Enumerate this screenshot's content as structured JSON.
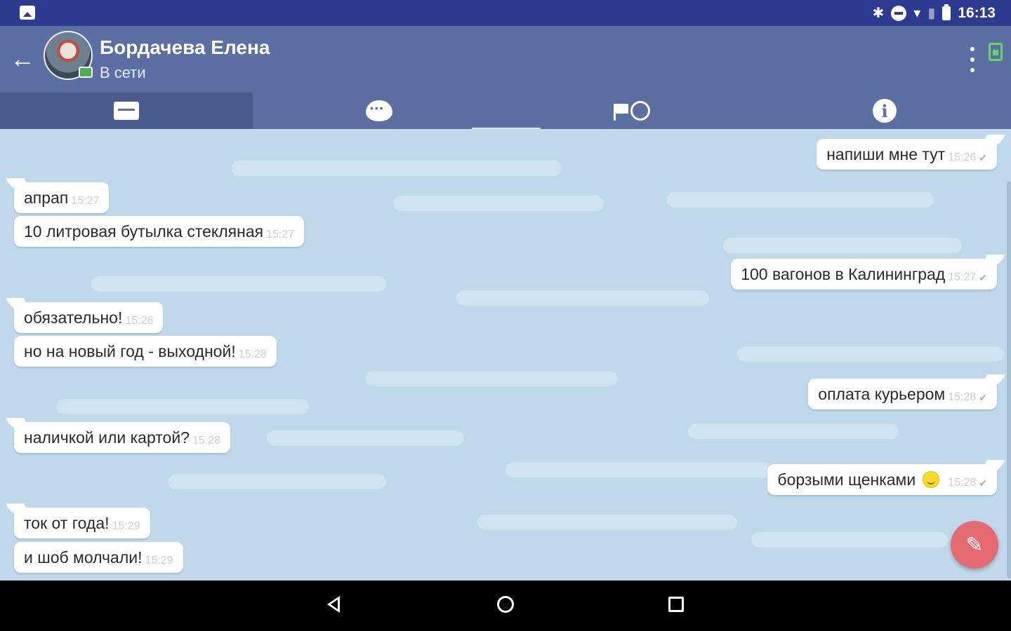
{
  "status_bar": {
    "time": "16:13",
    "icons": [
      "gallery-icon",
      "bluetooth-icon",
      "dnd-icon",
      "wifi-icon",
      "no-sim-icon",
      "battery-icon"
    ],
    "bg_color": "#2c3a8f"
  },
  "header": {
    "contact_name": "Бордачева Елена",
    "contact_status": "В сети",
    "bg_color": "#5c6fa3"
  },
  "tabs": [
    {
      "icon": "folder-icon",
      "active": true
    },
    {
      "icon": "chat-bubble-icon",
      "active": false
    },
    {
      "icon": "flag-alarm-icon",
      "active": false
    },
    {
      "icon": "info-icon",
      "active": false
    }
  ],
  "messages": [
    {
      "direction": "out",
      "text": "напиши мне тут",
      "time": "15:26",
      "read": true
    },
    {
      "direction": "in",
      "text": "апрап",
      "time": "15:27"
    },
    {
      "direction": "in",
      "text": "10 литровая бутылка стекляная",
      "time": "15:27"
    },
    {
      "direction": "out",
      "text": "100 вагонов в Калининград",
      "time": "15:27",
      "read": true
    },
    {
      "direction": "in",
      "text": "обязательно!",
      "time": "15:28"
    },
    {
      "direction": "in",
      "text": "но на новый год - выходной!",
      "time": "15:28"
    },
    {
      "direction": "out",
      "text": "оплата курьером",
      "time": "15:28",
      "read": true
    },
    {
      "direction": "in",
      "text": "наличкой или картой?",
      "time": "15:28"
    },
    {
      "direction": "out",
      "text": "борзыми щенками",
      "time": "15:28",
      "read": true,
      "emoji": "smile-emoji-icon"
    },
    {
      "direction": "in",
      "text": "ток от года!",
      "time": "15:29"
    },
    {
      "direction": "in",
      "text": "и шоб молчали!",
      "time": "15:29"
    }
  ],
  "fab": {
    "icon": "pencil-icon",
    "color": "#e56a72"
  },
  "nav_bar": {
    "icons": [
      "nav-back-icon",
      "nav-home-icon",
      "nav-recents-icon"
    ]
  },
  "colors": {
    "chat_bg": "#bfd9ea",
    "bubble": "#ffffff",
    "time_text": "#c8cfda"
  }
}
